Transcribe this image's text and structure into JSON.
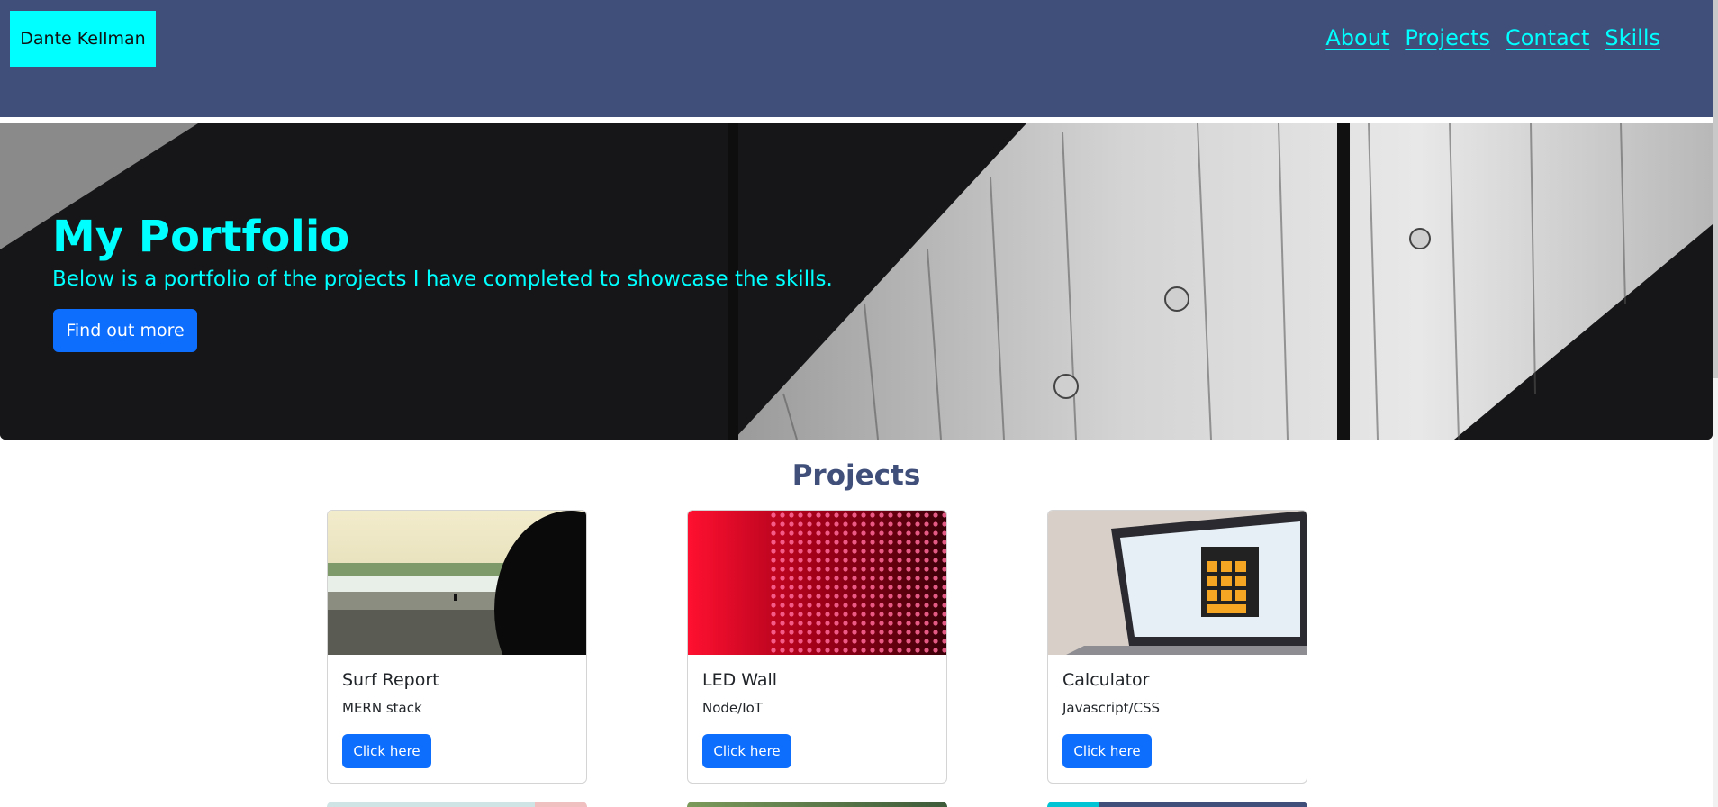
{
  "header": {
    "brand": "Dante Kellman",
    "nav": [
      "About",
      "Projects",
      "Contact",
      "Skills"
    ]
  },
  "hero": {
    "title": "My Portfolio",
    "subtitle": "Below is a portfolio of the projects I have completed to showcase the skills.",
    "button": "Find out more"
  },
  "projects": {
    "title": "Projects",
    "cards": [
      {
        "title": "Surf Report",
        "stack": "MERN stack",
        "button": "Click here"
      },
      {
        "title": "LED Wall",
        "stack": "Node/IoT",
        "button": "Click here"
      },
      {
        "title": "Calculator",
        "stack": "Javascript/CSS",
        "button": "Click here"
      }
    ]
  },
  "colors": {
    "header_bg": "#3f4f7a",
    "accent": "#00ffff",
    "button": "#0d6efd"
  }
}
